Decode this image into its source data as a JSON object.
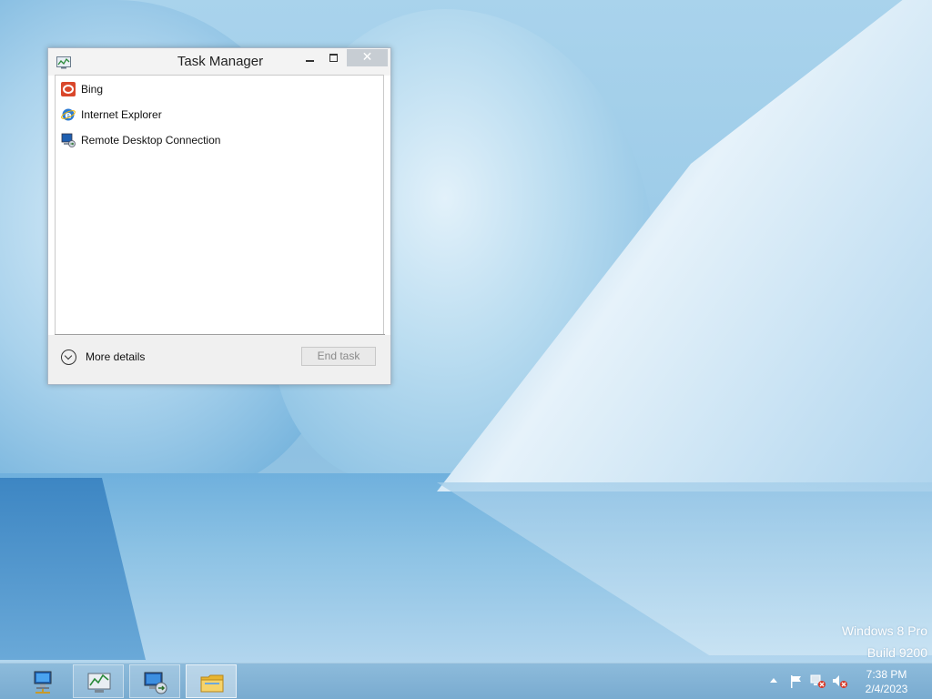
{
  "window": {
    "title": "Task Manager",
    "close_glyph": "✕",
    "apps": [
      {
        "label": "Bing",
        "icon": "bing-icon"
      },
      {
        "label": "Internet Explorer",
        "icon": "internet-explorer-icon"
      },
      {
        "label": "Remote Desktop Connection",
        "icon": "remote-desktop-icon"
      }
    ],
    "more_details_label": "More details",
    "end_task_label": "End task"
  },
  "watermark": {
    "line1": "Windows 8 Pro",
    "line2": "Build 9200"
  },
  "taskbar": {
    "items": [
      {
        "name": "network-computer-icon"
      },
      {
        "name": "task-manager-icon"
      },
      {
        "name": "remote-desktop-icon"
      },
      {
        "name": "file-explorer-icon"
      }
    ],
    "tray_icons": [
      "show-hidden-icons-arrow",
      "action-center-flag-icon",
      "network-disconnected-icon",
      "volume-muted-icon"
    ],
    "clock": {
      "time": "7:38 PM",
      "date": "2/4/2023"
    }
  },
  "colors": {
    "close_button": "#c7cdd3",
    "taskbar": "#79abd0",
    "bing_red": "#d9472b",
    "ie_blue": "#2b7bd4"
  }
}
